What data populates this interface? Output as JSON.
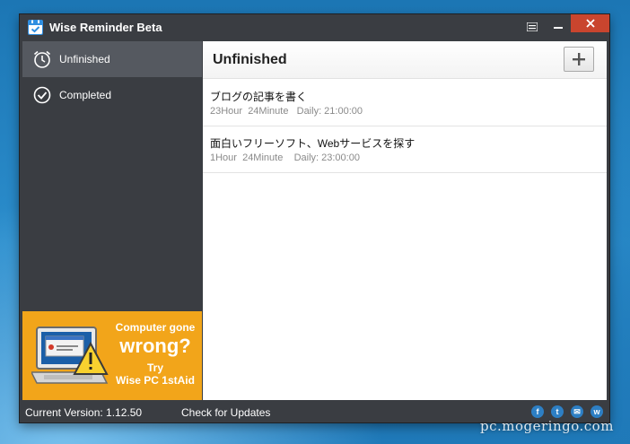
{
  "window": {
    "title": "Wise Reminder Beta"
  },
  "sidebar": {
    "items": [
      {
        "label": "Unfinished",
        "icon": "alarm-clock-icon",
        "active": true
      },
      {
        "label": "Completed",
        "icon": "check-circle-icon",
        "active": false
      }
    ]
  },
  "ad": {
    "line1": "Computer gone",
    "line2": "wrong?",
    "line3": "Try",
    "line4": "Wise PC 1stAid",
    "bg_color": "#f2a51a"
  },
  "content": {
    "title": "Unfinished",
    "add_label": "+",
    "tasks": [
      {
        "title": "ブログの記事を書く",
        "remaining": "23Hour  24Minute",
        "schedule": "Daily: 21:00:00"
      },
      {
        "title": "面白いフリーソフト、Webサービスを探す",
        "remaining": "1Hour  24Minute",
        "schedule": "Daily: 23:00:00"
      }
    ]
  },
  "statusbar": {
    "version": "Current Version: 1.12.50",
    "check_updates": "Check for Updates",
    "social": [
      "f",
      "t",
      "✉",
      "w"
    ]
  },
  "watermark": "pc.mogeringo.com",
  "colors": {
    "titlebar": "#3a3d42",
    "close": "#c9452e",
    "sidebar_active": "#555960",
    "accent": "#2f8ee0"
  }
}
